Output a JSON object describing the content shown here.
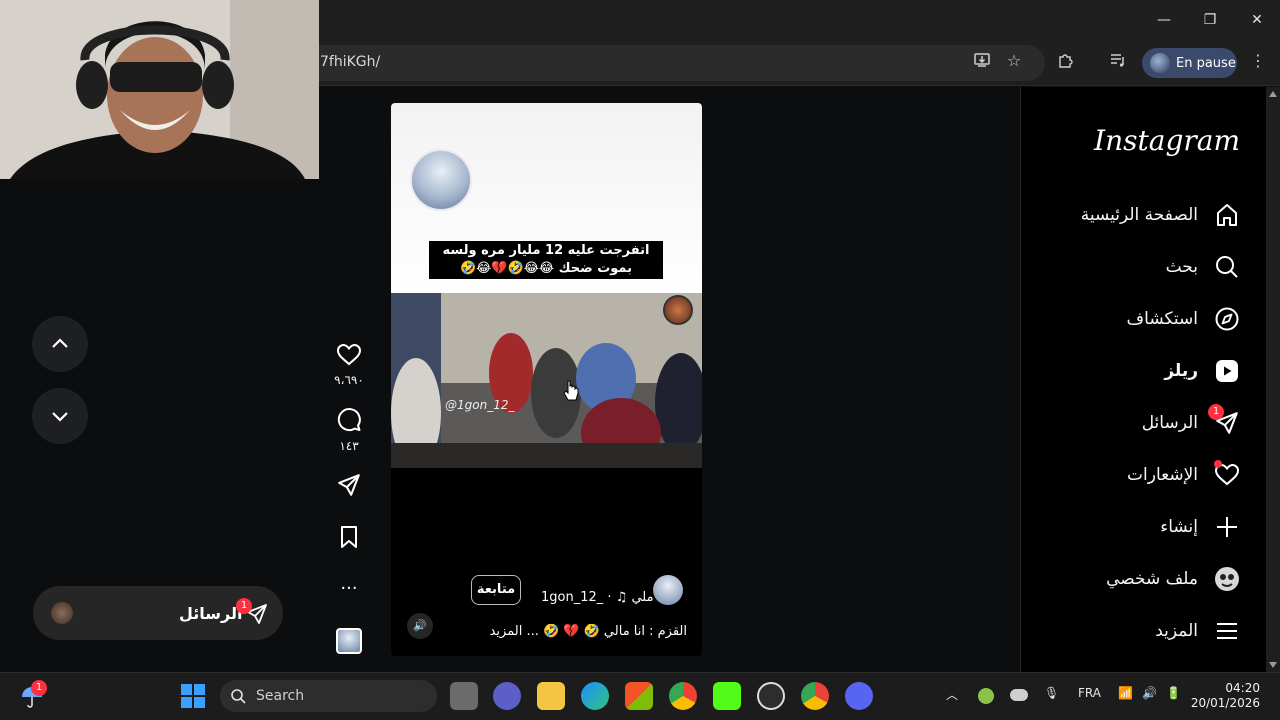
{
  "browser": {
    "url_fragment": "7fhiKGh/",
    "profile_label": "En pause",
    "window_controls": {
      "minimize": "—",
      "restore": "❐",
      "close": "✕"
    }
  },
  "instagram": {
    "logo": "Instagram",
    "nav": [
      {
        "key": "home",
        "label": "الصفحة الرئيسية",
        "icon": "home-icon"
      },
      {
        "key": "search",
        "label": "بحث",
        "icon": "search-icon"
      },
      {
        "key": "explore",
        "label": "استكشاف",
        "icon": "compass-icon"
      },
      {
        "key": "reels",
        "label": "ريلز",
        "icon": "reels-icon"
      },
      {
        "key": "messages",
        "label": "الرسائل",
        "icon": "send-icon",
        "badge": "1"
      },
      {
        "key": "notifications",
        "label": "الإشعارات",
        "icon": "heart-icon"
      },
      {
        "key": "create",
        "label": "إنشاء",
        "icon": "plus-icon"
      },
      {
        "key": "profile",
        "label": "ملف شخصي",
        "icon": "avatar-icon"
      },
      {
        "key": "more",
        "label": "المزيد",
        "icon": "menu-icon"
      }
    ]
  },
  "reel": {
    "caption_overlay": "اتفرجت عليه 12 مليار مره ولسه بموت ضحك 😂😂🤣💔😂🤣",
    "watermark": "@1gon_12_",
    "author": "1gon_12_ · ♫ ملي",
    "follow_label": "متابعة",
    "caption": "القزم : انا مالي 🤣 💔 🤣 ... المزيد",
    "likes": "٩،٦٩٠",
    "comments": "١٤٣"
  },
  "messages_pill": {
    "label": "الرسائل",
    "badge": "1"
  },
  "taskbar": {
    "search_label": "Search",
    "language": "FRA",
    "time": "04:20",
    "date": "20/01/2026",
    "weather_badge": "1"
  }
}
